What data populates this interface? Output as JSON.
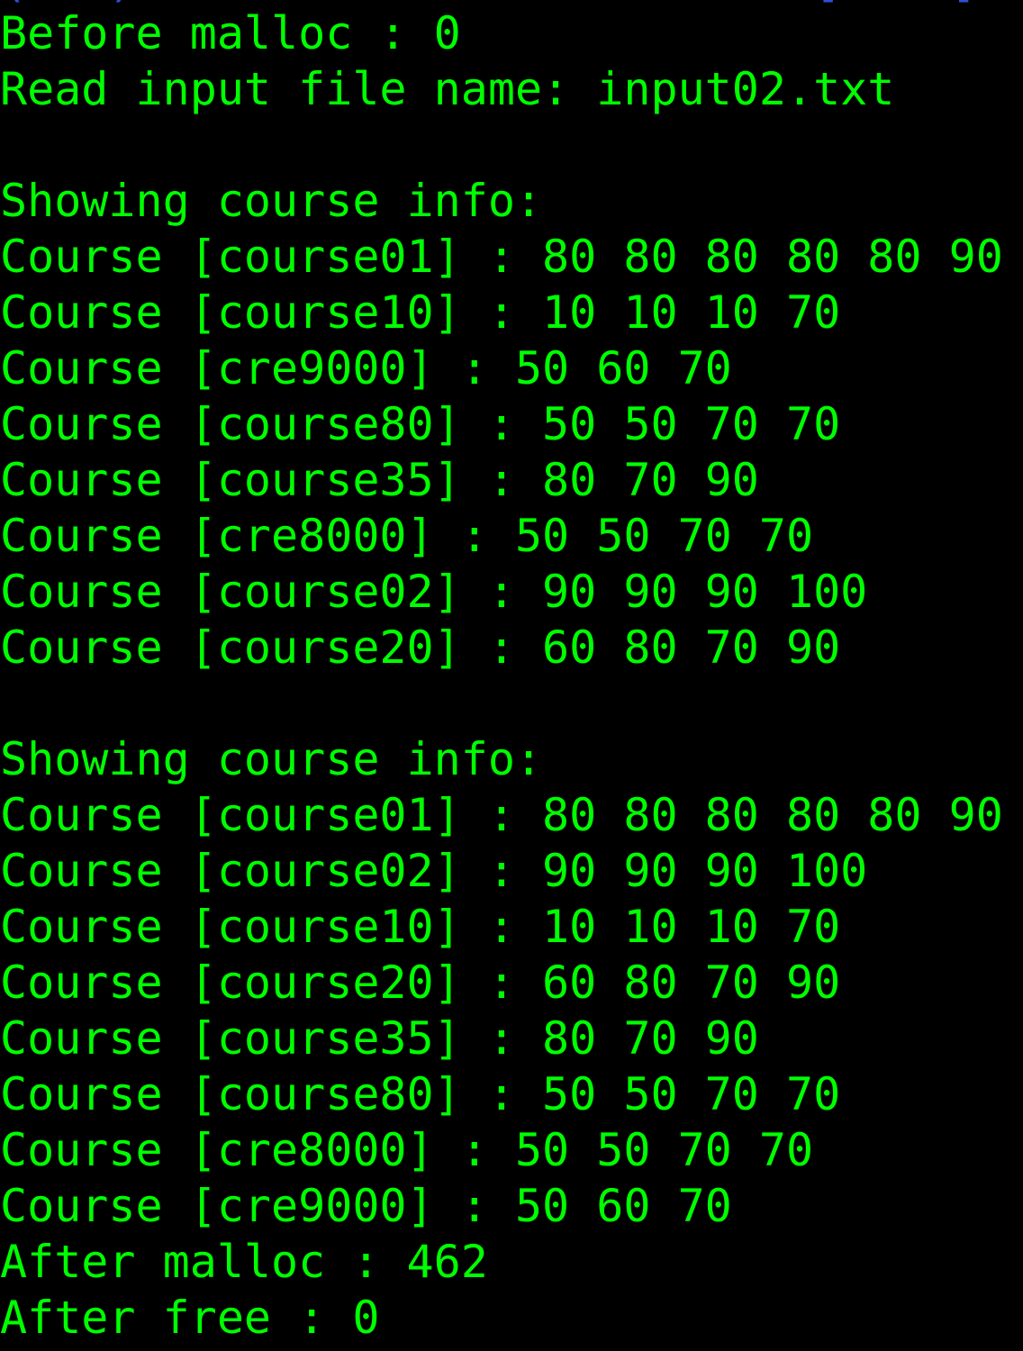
{
  "terminal": {
    "top_remnant": "(   )                         [    [             ]",
    "lines": [
      "Before malloc : 0",
      "Read input file name: input02.txt",
      "",
      "Showing course info:",
      "Course [course01] : 80 80 80 80 80 90",
      "Course [course10] : 10 10 10 70",
      "Course [cre9000] : 50 60 70",
      "Course [course80] : 50 50 70 70",
      "Course [course35] : 80 70 90",
      "Course [cre8000] : 50 50 70 70",
      "Course [course02] : 90 90 90 100",
      "Course [course20] : 60 80 70 90",
      "",
      "Showing course info:",
      "Course [course01] : 80 80 80 80 80 90",
      "Course [course02] : 90 90 90 100",
      "Course [course10] : 10 10 10 70",
      "Course [course20] : 60 80 70 90",
      "Course [course35] : 80 70 90",
      "Course [course80] : 50 50 70 70",
      "Course [cre8000] : 50 50 70 70",
      "Course [cre9000] : 50 60 70",
      "After malloc : 462",
      "After free : 0"
    ]
  },
  "colors": {
    "background": "#000000",
    "text": "#00ff00",
    "prompt_remnant": "#2f4fd8"
  }
}
